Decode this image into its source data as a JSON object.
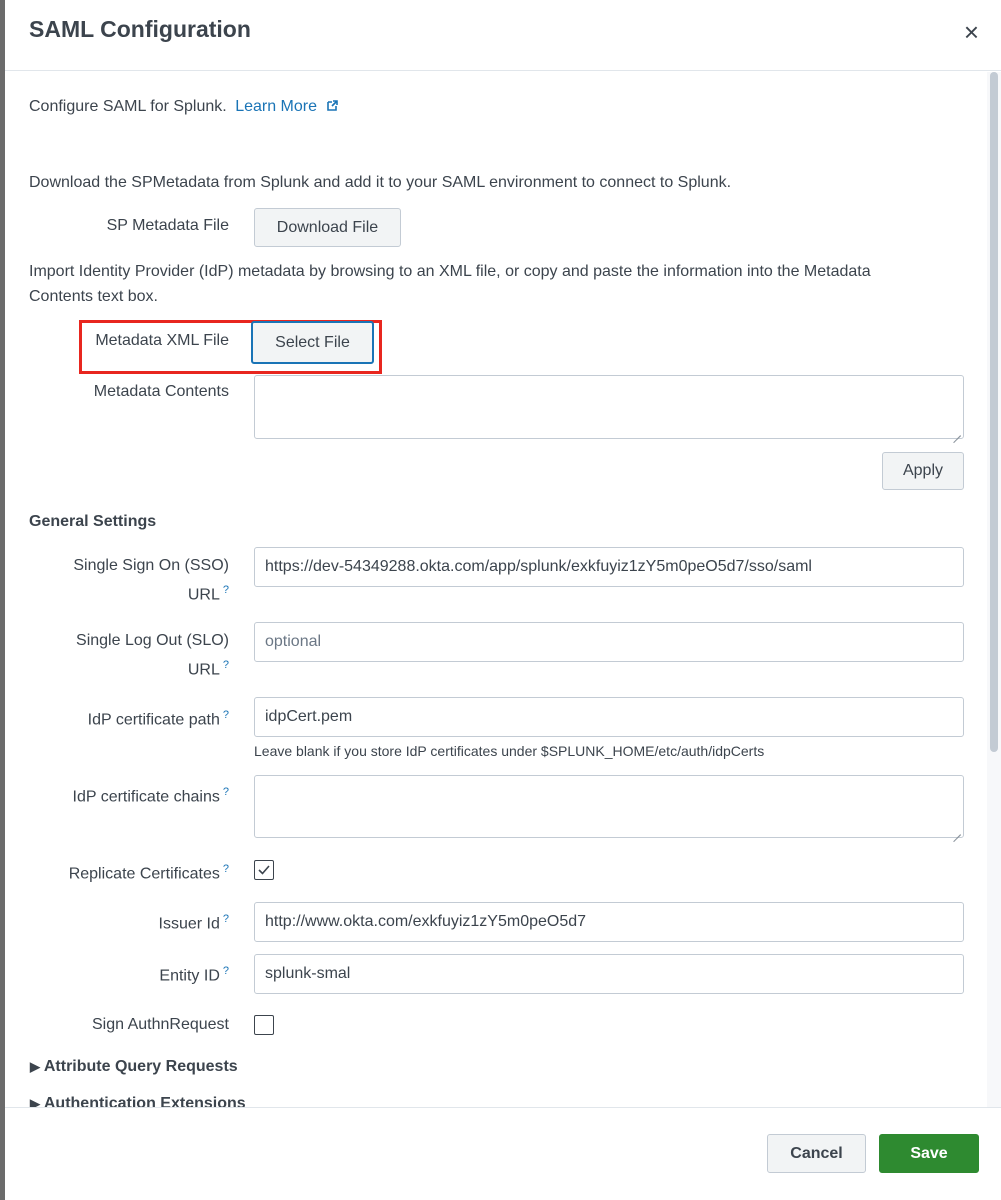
{
  "modal": {
    "title": "SAML Configuration",
    "close_icon": "×"
  },
  "intro": {
    "text": "Configure SAML for Splunk.",
    "learn_more": "Learn More"
  },
  "sp_metadata": {
    "description": "Download the SPMetadata from Splunk and add it to your SAML environment to connect to Splunk.",
    "label": "SP Metadata File",
    "button": "Download File"
  },
  "idp_import": {
    "description_line1": "Import Identity Provider (IdP) metadata by browsing to an XML file, or copy and paste the information into the Metadata",
    "description_line2": "Contents text box.",
    "xml_label": "Metadata XML File",
    "select_button": "Select File",
    "contents_label": "Metadata Contents",
    "contents_value": "",
    "apply_button": "Apply"
  },
  "general_settings": {
    "heading": "General Settings",
    "sso_label_line1": "Single Sign On (SSO)",
    "sso_label_line2": "URL",
    "sso_value": "https://dev-54349288.okta.com/app/splunk/exkfuyiz1zY5m0peO5d7/sso/saml",
    "slo_label_line1": "Single Log Out (SLO)",
    "slo_label_line2": "URL",
    "slo_placeholder": "optional",
    "cert_path_label": "IdP certificate path",
    "cert_path_value": "idpCert.pem",
    "cert_path_hint": "Leave blank if you store IdP certificates under $SPLUNK_HOME/etc/auth/idpCerts",
    "cert_chains_label": "IdP certificate chains",
    "replicate_label": "Replicate Certificates",
    "replicate_checked": true,
    "issuer_label": "Issuer Id",
    "issuer_value": "http://www.okta.com/exkfuyiz1zY5m0peO5d7",
    "entity_label": "Entity ID",
    "entity_value": "splunk-smal",
    "sign_authn_label": "Sign AuthnRequest",
    "sign_authn_checked": false,
    "help_mark": "?"
  },
  "collapsibles": {
    "attribute_query": "Attribute Query Requests",
    "auth_extensions": "Authentication Extensions"
  },
  "footer": {
    "cancel": "Cancel",
    "save": "Save"
  },
  "colors": {
    "link": "#1a74b6",
    "save_button": "#2e8a30",
    "highlight_box": "#e8261f",
    "focus_ring": "#1a74b6"
  }
}
